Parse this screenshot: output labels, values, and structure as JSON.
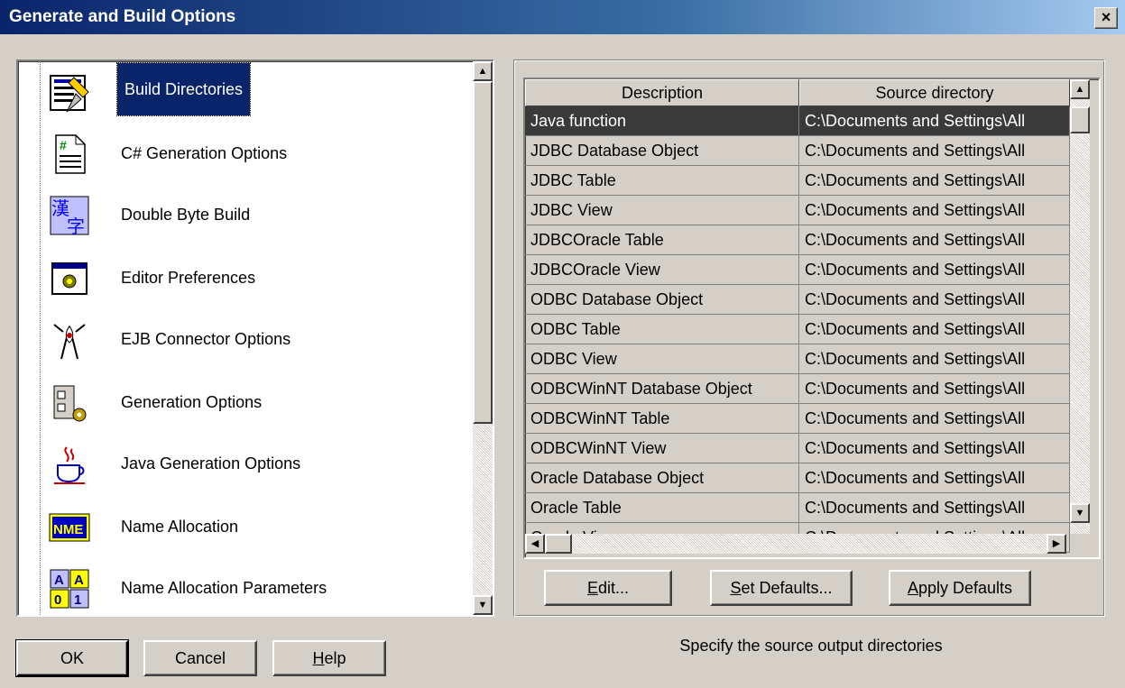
{
  "window": {
    "title": "Generate and Build Options",
    "close_label": "×"
  },
  "tree": {
    "items": [
      {
        "label": "Build Directories",
        "icon": "build-directories-icon",
        "selected": true
      },
      {
        "label": "C# Generation Options",
        "icon": "csharp-doc-icon"
      },
      {
        "label": "Double Byte Build",
        "icon": "double-byte-icon"
      },
      {
        "label": "Editor Preferences",
        "icon": "editor-preferences-icon"
      },
      {
        "label": "EJB Connector Options",
        "icon": "ejb-connector-icon"
      },
      {
        "label": "Generation Options",
        "icon": "generation-options-icon"
      },
      {
        "label": "Java Generation Options",
        "icon": "java-cup-icon"
      },
      {
        "label": "Name Allocation",
        "icon": "name-allocation-icon"
      },
      {
        "label": "Name Allocation Parameters",
        "icon": "name-allocation-parameters-icon"
      }
    ],
    "icon_text": {
      "double_byte_top": "漢",
      "double_byte_bottom": "字",
      "nme": "NME",
      "param_a1": "A",
      "param_a2": "A",
      "param_0": "0",
      "param_1": "1",
      "csharp": "#"
    }
  },
  "table": {
    "columns": [
      "Description",
      "Source directory"
    ],
    "rows": [
      {
        "description": "Java function",
        "source": "C:\\Documents and Settings\\All",
        "selected": true
      },
      {
        "description": "JDBC Database Object",
        "source": "C:\\Documents and Settings\\All"
      },
      {
        "description": "JDBC Table",
        "source": "C:\\Documents and Settings\\All"
      },
      {
        "description": "JDBC View",
        "source": "C:\\Documents and Settings\\All"
      },
      {
        "description": "JDBCOracle Table",
        "source": "C:\\Documents and Settings\\All"
      },
      {
        "description": "JDBCOracle View",
        "source": "C:\\Documents and Settings\\All"
      },
      {
        "description": "ODBC Database Object",
        "source": "C:\\Documents and Settings\\All"
      },
      {
        "description": "ODBC Table",
        "source": "C:\\Documents and Settings\\All"
      },
      {
        "description": "ODBC View",
        "source": "C:\\Documents and Settings\\All"
      },
      {
        "description": "ODBCWinNT Database Object",
        "source": "C:\\Documents and Settings\\All"
      },
      {
        "description": "ODBCWinNT Table",
        "source": "C:\\Documents and Settings\\All"
      },
      {
        "description": "ODBCWinNT View",
        "source": "C:\\Documents and Settings\\All"
      },
      {
        "description": "Oracle Database Object",
        "source": "C:\\Documents and Settings\\All"
      },
      {
        "description": "Oracle Table",
        "source": "C:\\Documents and Settings\\All"
      },
      {
        "description": "Oracle View",
        "source": "C:\\Documents and Settings\\All"
      }
    ]
  },
  "buttons": {
    "edit": {
      "mnemonic": "E",
      "rest": "dit..."
    },
    "set_defaults": {
      "mnemonic": "S",
      "rest": "et Defaults..."
    },
    "apply_defaults": {
      "mnemonic": "A",
      "rest": "pply Defaults"
    },
    "ok": "OK",
    "cancel": "Cancel",
    "help": {
      "mnemonic": "H",
      "rest": "elp"
    }
  },
  "status": {
    "description": "Specify the source output directories"
  },
  "scroll_glyphs": {
    "up": "▲",
    "down": "▼",
    "left": "◀",
    "right": "▶"
  },
  "colors": {
    "title_start": "#0a246a",
    "title_end": "#a6caf0",
    "selection": "#0a246a",
    "grid_selection": "#3a3a3a",
    "face": "#d4d0c8"
  }
}
